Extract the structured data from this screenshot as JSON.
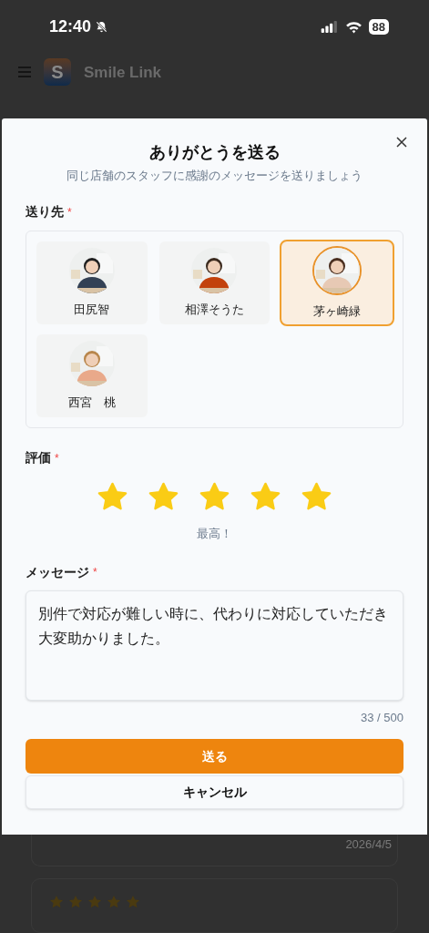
{
  "status_bar": {
    "time": "12:40",
    "battery": "88"
  },
  "header": {
    "logo_letter": "S",
    "app_name": "Smile Link"
  },
  "dialog": {
    "title": "ありがとうを送る",
    "subtitle": "同じ店舗のスタッフに感謝のメッセージを送りましょう",
    "recipient_label": "送り先",
    "required_mark": "*",
    "recipients": [
      {
        "name": "田尻智",
        "selected": false
      },
      {
        "name": "相澤そうた",
        "selected": false
      },
      {
        "name": "茅ヶ崎緑",
        "selected": true
      },
      {
        "name": "西宮　桃",
        "selected": false
      }
    ],
    "rating_label": "評価",
    "rating": {
      "stars": 5
    },
    "rating_caption": "最高！",
    "message_label": "メッセージ",
    "message": "別件で対応が難しい時に、代わりに対応していただき大変助かりました。",
    "char_count": "33 / 500",
    "send_button": "送る",
    "cancel_button": "キャンセル"
  },
  "background_cards": [
    {
      "date": "2026/4/5"
    },
    {
      "stars": 5
    }
  ]
}
